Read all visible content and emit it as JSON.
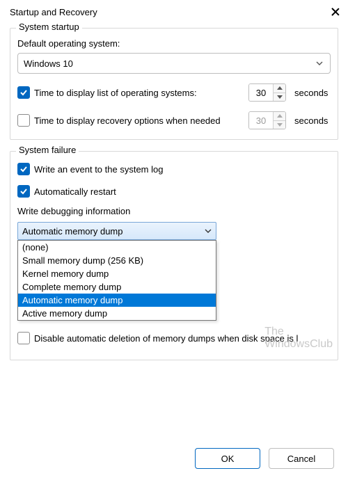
{
  "window": {
    "title": "Startup and Recovery"
  },
  "startup": {
    "legend": "System startup",
    "default_os_label": "Default operating system:",
    "default_os_value": "Windows 10",
    "display_os_list_label": "Time to display list of operating systems:",
    "display_os_list_value": "30",
    "display_recovery_label": "Time to display recovery options when needed",
    "display_recovery_value": "30",
    "seconds_unit": "seconds"
  },
  "failure": {
    "legend": "System failure",
    "write_event_label": "Write an event to the system log",
    "auto_restart_label": "Automatically restart",
    "debug_label": "Write debugging information",
    "combo_value": "Automatic memory dump",
    "options": {
      "0": "(none)",
      "1": "Small memory dump (256 KB)",
      "2": "Kernel memory dump",
      "3": "Complete memory dump",
      "4": "Automatic memory dump",
      "5": "Active memory dump"
    },
    "disable_auto_delete_label": "Disable automatic deletion of memory dumps when disk space is l"
  },
  "buttons": {
    "ok": "OK",
    "cancel": "Cancel"
  },
  "watermark": {
    "line1": "The",
    "line2": "WindowsClub"
  }
}
